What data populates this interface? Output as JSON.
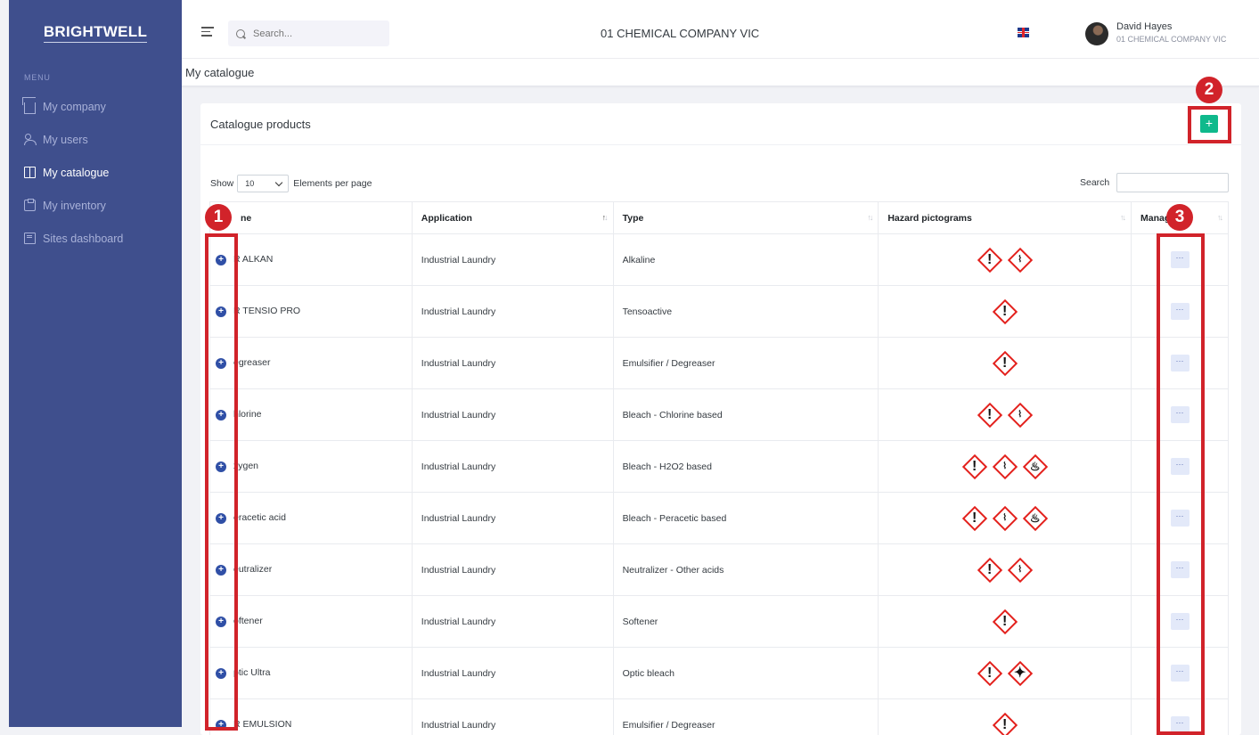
{
  "sidebar": {
    "brand": "BRIGHTWELL",
    "menu_title": "MENU",
    "items": [
      {
        "label": "My company",
        "icon": "home-icon"
      },
      {
        "label": "My users",
        "icon": "users-icon"
      },
      {
        "label": "My catalogue",
        "icon": "book-icon",
        "active": true
      },
      {
        "label": "My inventory",
        "icon": "clipboard-icon"
      },
      {
        "label": "Sites dashboard",
        "icon": "dashboard-icon"
      }
    ]
  },
  "topbar": {
    "search_placeholder": "Search...",
    "company": "01 CHEMICAL COMPANY VIC",
    "user_name": "David Hayes",
    "user_company": "01 CHEMICAL COMPANY VIC"
  },
  "page": {
    "title": "My catalogue"
  },
  "card": {
    "title": "Catalogue products",
    "add_label": "+",
    "show_label": "Show",
    "page_size": "10",
    "per_page_label": "Elements per page",
    "search_label": "Search"
  },
  "table": {
    "columns": [
      "ne",
      "Application",
      "Type",
      "Hazard pictograms",
      "Manag"
    ],
    "rows": [
      {
        "name": "R ALKAN",
        "application": "Industrial Laundry",
        "type": "Alkaline",
        "hazards": [
          "exclamation",
          "corrosive"
        ]
      },
      {
        "name": "R TENSIO PRO",
        "application": "Industrial Laundry",
        "type": "Tensoactive",
        "hazards": [
          "exclamation"
        ]
      },
      {
        "name": "egreaser",
        "application": "Industrial Laundry",
        "type": "Emulsifier / Degreaser",
        "hazards": [
          "exclamation"
        ]
      },
      {
        "name": "hlorine",
        "application": "Industrial Laundry",
        "type": "Bleach - Chlorine based",
        "hazards": [
          "exclamation",
          "corrosive"
        ]
      },
      {
        "name": "xygen",
        "application": "Industrial Laundry",
        "type": "Bleach - H2O2 based",
        "hazards": [
          "exclamation",
          "corrosive",
          "oxidizer"
        ]
      },
      {
        "name": "eracetic acid",
        "application": "Industrial Laundry",
        "type": "Bleach - Peracetic based",
        "hazards": [
          "exclamation",
          "corrosive",
          "oxidizer"
        ]
      },
      {
        "name": "eutralizer",
        "application": "Industrial Laundry",
        "type": "Neutralizer - Other acids",
        "hazards": [
          "exclamation",
          "corrosive"
        ]
      },
      {
        "name": "oftener",
        "application": "Industrial Laundry",
        "type": "Softener",
        "hazards": [
          "exclamation"
        ]
      },
      {
        "name": "ptic Ultra",
        "application": "Industrial Laundry",
        "type": "Optic bleach",
        "hazards": [
          "exclamation",
          "health-hazard"
        ]
      },
      {
        "name": "R EMULSION",
        "application": "Industrial Laundry",
        "type": "Emulsifier / Degreaser",
        "hazards": [
          "exclamation"
        ]
      }
    ],
    "manage_label": "···"
  },
  "annotations": [
    "1",
    "2",
    "3"
  ],
  "colors": {
    "sidebar": "#3f4f8d",
    "accent_add": "#0fb98c",
    "hazard_red": "#e3201c",
    "annotation_red": "#d1232a"
  }
}
